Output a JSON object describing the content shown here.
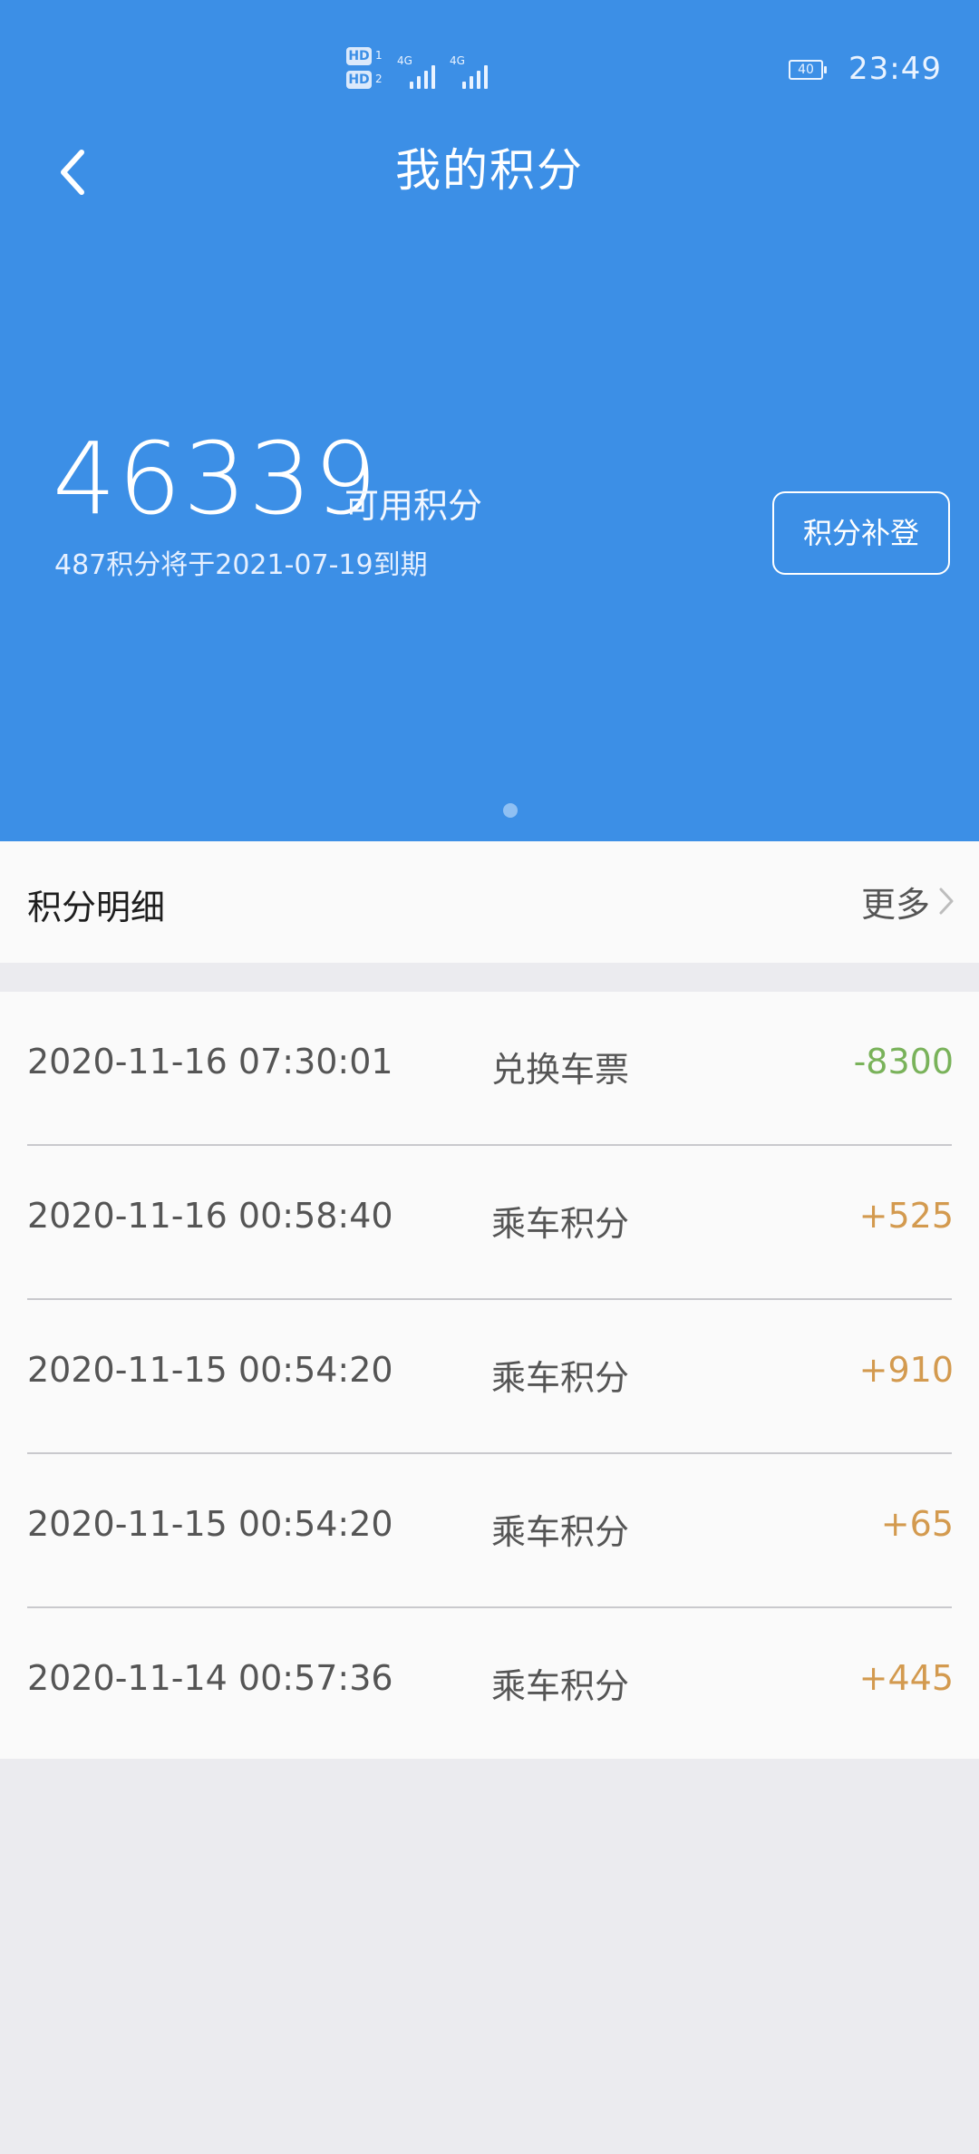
{
  "status_bar": {
    "hd_label": "HD",
    "sim1_number": "1",
    "sim2_number": "2",
    "network": "4G",
    "battery": "40",
    "time": "23:49"
  },
  "header": {
    "title": "我的积分"
  },
  "points": {
    "value": "46339",
    "label": "可用积分",
    "expiry_note": "487积分将于2021-07-19到期",
    "supplement_button": "积分补登"
  },
  "details": {
    "title": "积分明细",
    "more_label": "更多"
  },
  "records": [
    {
      "time": "2020-11-16 07:30:01",
      "type": "兑换车票",
      "amount": "-8300",
      "amount_color": "#79b25a"
    },
    {
      "time": "2020-11-16 00:58:40",
      "type": "乘车积分",
      "amount": "+525",
      "amount_color": "#d39a4f"
    },
    {
      "time": "2020-11-15 00:54:20",
      "type": "乘车积分",
      "amount": "+910",
      "amount_color": "#d39a4f"
    },
    {
      "time": "2020-11-15 00:54:20",
      "type": "乘车积分",
      "amount": "+65",
      "amount_color": "#d39a4f"
    },
    {
      "time": "2020-11-14 00:57:36",
      "type": "乘车积分",
      "amount": "+445",
      "amount_color": "#d39a4f"
    }
  ],
  "colors": {
    "header_blue": "#3c8fe6",
    "list_background": "#fafafa",
    "page_background": "#ebebef",
    "positive_amount": "#d39a4f",
    "negative_amount": "#79b25a"
  },
  "icons": {
    "back": "chevron-left-icon",
    "more": "chevron-right-icon",
    "signal": "signal-bars-icon",
    "battery": "battery-icon"
  }
}
